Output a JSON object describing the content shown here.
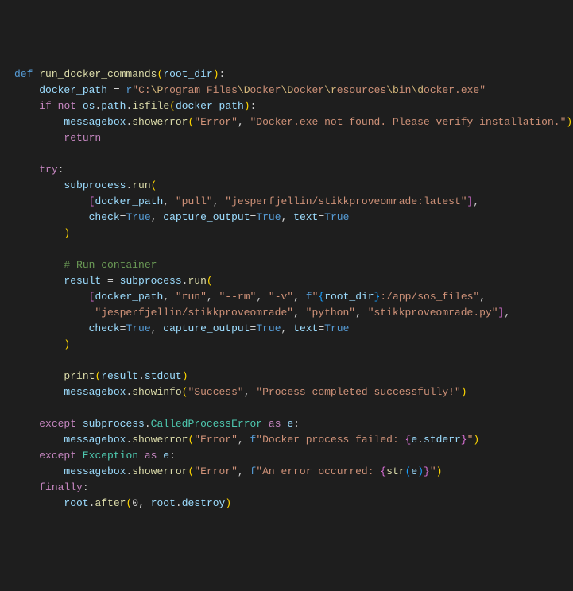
{
  "code": {
    "l1": {
      "def": "def",
      "fn": "run_docker_commands",
      "p": "root_dir"
    },
    "l2": {
      "v": "docker_path",
      "eq": " = ",
      "r": "r",
      "s": "\"C:",
      "e1": "\\P",
      "s2": "rogram Files",
      "e2": "\\D",
      "s3": "ocker",
      "e3": "\\D",
      "s4": "ocker",
      "e4": "\\r",
      "s5": "esources",
      "e5": "\\b",
      "s6": "in",
      "e6": "\\d",
      "s7": "ocker.exe\""
    },
    "l3": {
      "if": "if",
      "not": "not",
      "os": "os",
      "path": "path",
      "isfile": "isfile",
      "arg": "docker_path"
    },
    "l4": {
      "mb": "messagebox",
      "se": "showerror",
      "a1": "\"Error\"",
      "a2": "\"Docker.exe not found. Please verify installation.\""
    },
    "l5": {
      "ret": "return"
    },
    "l7": {
      "try": "try"
    },
    "l8": {
      "sp": "subprocess",
      "run": "run"
    },
    "l9": {
      "dp": "docker_path",
      "pull": "\"pull\"",
      "img": "\"jesperfjellin/stikkproveomrade:latest\""
    },
    "l10": {
      "check": "check",
      "t1": "True",
      "co": "capture_output",
      "t2": "True",
      "txt": "text",
      "t3": "True"
    },
    "l13": {
      "cmt": "# Run container"
    },
    "l14": {
      "res": "result",
      "sp": "subprocess",
      "run": "run"
    },
    "l15": {
      "dp": "docker_path",
      "run": "\"run\"",
      "rm": "\"--rm\"",
      "v": "\"-v\"",
      "f": "f",
      "s1": "\"",
      "rd": "root_dir",
      "s2": ":/app/sos_files\""
    },
    "l16": {
      "img": "\"jesperfjellin/stikkproveomrade\"",
      "py": "\"python\"",
      "scr": "\"stikkproveomrade.py\""
    },
    "l17": {
      "check": "check",
      "t1": "True",
      "co": "capture_output",
      "t2": "True",
      "txt": "text",
      "t3": "True"
    },
    "l20": {
      "print": "print",
      "res": "result",
      "stdout": "stdout"
    },
    "l21": {
      "mb": "messagebox",
      "si": "showinfo",
      "a1": "\"Success\"",
      "a2": "\"Process completed successfully!\""
    },
    "l23": {
      "exc": "except",
      "sp": "subprocess",
      "cpe": "CalledProcessError",
      "as": "as",
      "e": "e"
    },
    "l24": {
      "mb": "messagebox",
      "se": "showerror",
      "a1": "\"Error\"",
      "f": "f",
      "s1": "\"Docker process failed: ",
      "ev": "e",
      "stderr": "stderr",
      "s2": "\""
    },
    "l25": {
      "exc": "except",
      "Exc": "Exception",
      "as": "as",
      "e": "e"
    },
    "l26": {
      "mb": "messagebox",
      "se": "showerror",
      "a1": "\"Error\"",
      "f": "f",
      "s1": "\"An error occurred: ",
      "str": "str",
      "e": "e",
      "s2": "\""
    },
    "l27": {
      "fin": "finally"
    },
    "l28": {
      "root": "root",
      "after": "after",
      "zero": "0",
      "root2": "root",
      "destroy": "destroy"
    }
  }
}
